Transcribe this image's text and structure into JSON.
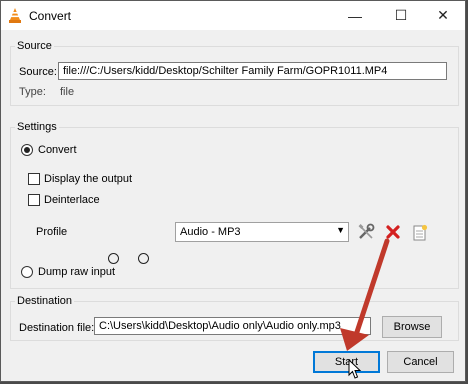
{
  "window": {
    "title": "Convert",
    "minimize_glyph": "—",
    "maximize_glyph": "☐",
    "close_glyph": "✕"
  },
  "source": {
    "legend": "Source",
    "source_label": "Source:",
    "source_value": "file:///C:/Users/kidd/Desktop/Schilter Family Farm/GOPR1011.MP4",
    "type_label": "Type:",
    "type_value": "file"
  },
  "settings": {
    "legend": "Settings",
    "convert_label": "Convert",
    "convert_selected": true,
    "display_output_label": "Display the output",
    "deinterlace_label": "Deinterlace",
    "profile_label": "Profile",
    "profile_value": "Audio - MP3",
    "dump_raw_label": "Dump raw input"
  },
  "destination": {
    "legend": "Destination",
    "file_label": "Destination file:",
    "file_value": "C:\\Users\\kidd\\Desktop\\Audio only\\Audio only.mp3",
    "browse_label": "Browse"
  },
  "footer": {
    "start_label": "Start",
    "cancel_label": "Cancel"
  },
  "icons": {
    "app": "vlc-cone-icon",
    "profile_edit": "wrench-screwdriver-icon",
    "profile_delete": "red-x-icon",
    "profile_new": "new-document-icon",
    "pointer": "mouse-cursor-icon"
  },
  "colors": {
    "accent": "#0078d7",
    "annotation_arrow": "#c0392b",
    "delete_red": "#d42020"
  }
}
